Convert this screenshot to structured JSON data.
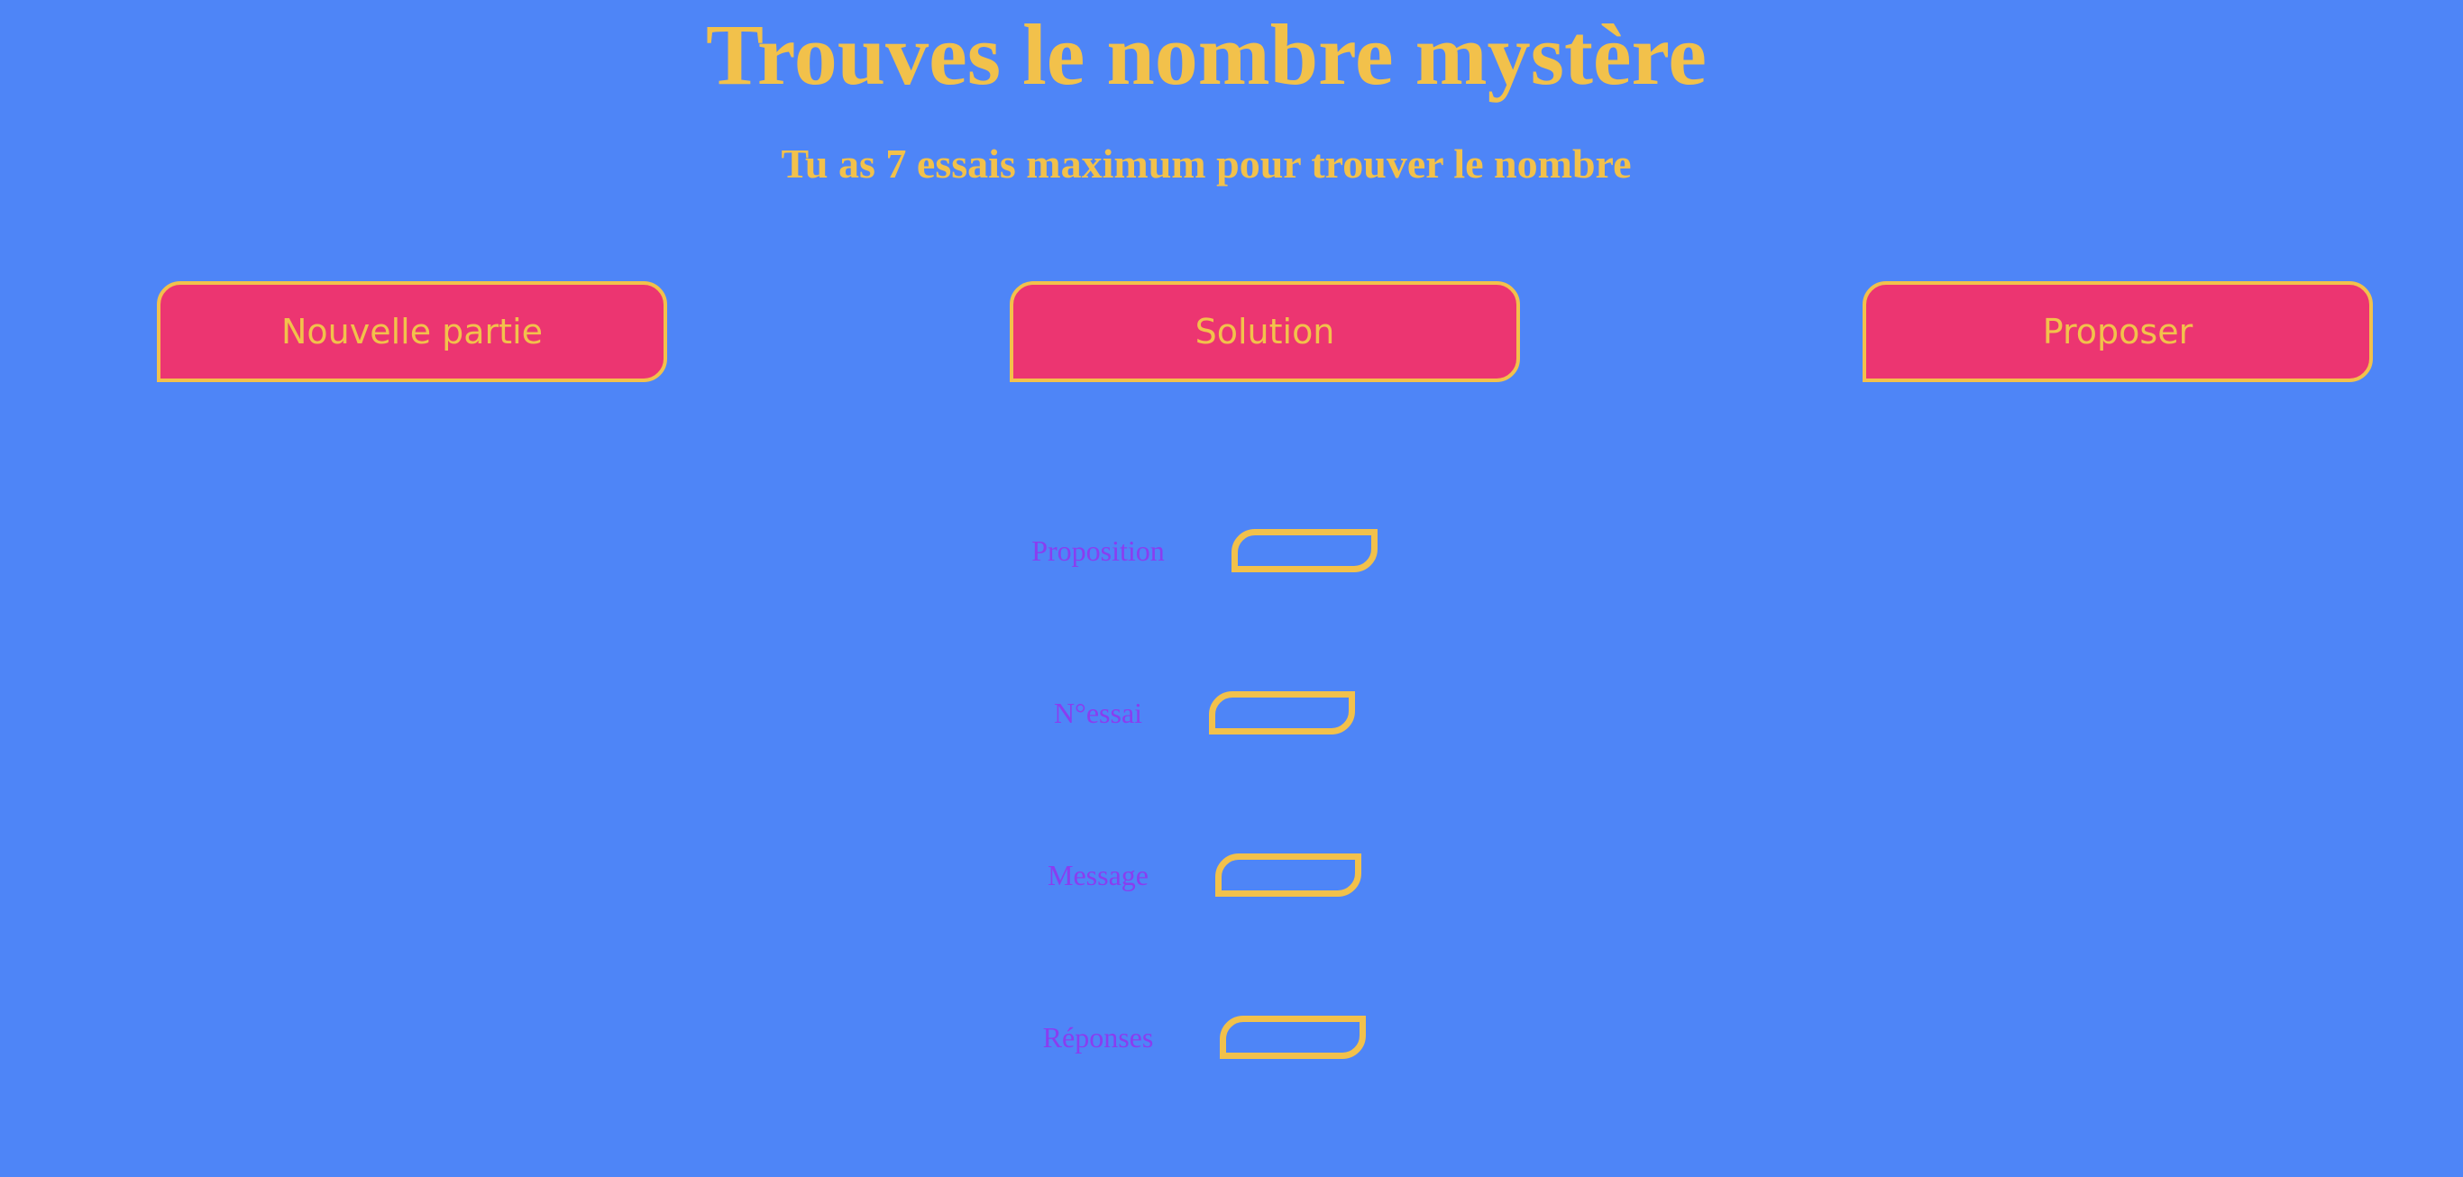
{
  "header": {
    "title": "Trouves le nombre mystère",
    "subtitle": "Tu as 7 essais maximum pour trouver le nombre"
  },
  "buttons": {
    "new_game": "Nouvelle partie",
    "solution": "Solution",
    "propose": "Proposer"
  },
  "form": {
    "proposition": {
      "label": "Proposition",
      "value": ""
    },
    "attempt": {
      "label": "N°essai",
      "value": ""
    },
    "message": {
      "label": "Message",
      "value": ""
    },
    "responses": {
      "label": "Réponses",
      "value": ""
    }
  },
  "colors": {
    "background": "#4e85f7",
    "accent": "#f2c14b",
    "button_fill": "#ec3571",
    "label": "#8a3df0"
  }
}
